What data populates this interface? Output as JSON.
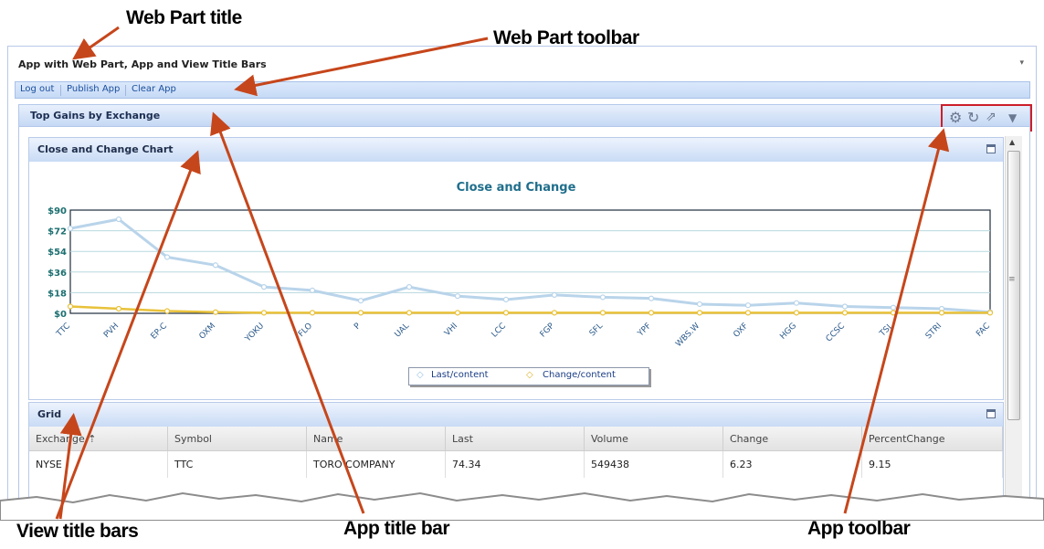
{
  "annotations": {
    "web_part_title": "Web Part title",
    "web_part_toolbar": "Web Part toolbar",
    "view_title_bars": "View title bars",
    "app_title_bar": "App title bar",
    "app_toolbar": "App toolbar"
  },
  "web_part": {
    "title": "App with Web Part, App and View Title Bars",
    "dropdown_glyph": "▾",
    "toolbar": {
      "log_out": "Log out",
      "publish_app": "Publish App",
      "clear_app": "Clear App"
    }
  },
  "app": {
    "title": "Top Gains by Exchange",
    "toolbar_icons": [
      "gear-icon",
      "refresh-icon",
      "popout-icon",
      "chevron-down-icon"
    ]
  },
  "views": {
    "chart_view_title": "Close and Change Chart",
    "grid_view_title": "Grid"
  },
  "chart_data": {
    "type": "line",
    "title": "Close and Change",
    "categories": [
      "TTC",
      "PVH",
      "EP-C",
      "OXM",
      "YOKU",
      "FLO",
      "P",
      "UAL",
      "VHI",
      "LCC",
      "FGP",
      "SFL",
      "YPF",
      "WBS.W",
      "OXF",
      "HGG",
      "CCSC",
      "TSL",
      "STRI",
      "FAC"
    ],
    "ytick_labels": [
      "$90",
      "$72",
      "$54",
      "$36",
      "$18",
      "$0"
    ],
    "ylim": [
      0,
      90
    ],
    "series": [
      {
        "name": "Last/content",
        "color": "#b9d4ea",
        "values": [
          74,
          82,
          49,
          42,
          23,
          20,
          11,
          23,
          15,
          12,
          16,
          14,
          13,
          8,
          7,
          9,
          6,
          5,
          4,
          1
        ]
      },
      {
        "name": "Change/content",
        "color": "#e9c23a",
        "values": [
          6,
          4,
          2,
          1,
          0.5,
          0.5,
          0.5,
          0.5,
          0.5,
          0.5,
          0.5,
          0.5,
          0.5,
          0.5,
          0.5,
          0.5,
          0.5,
          0.5,
          0.5,
          0.5
        ]
      }
    ],
    "legend_position": "bottom-center",
    "grid": true
  },
  "grid": {
    "columns": [
      "Exchange ⇡",
      "Symbol",
      "Name",
      "Last",
      "Volume",
      "Change",
      "PercentChange"
    ],
    "rows": [
      [
        "NYSE",
        "TTC",
        "TORO COMPANY",
        "74.34",
        "549438",
        "6.23",
        "9.15"
      ]
    ]
  }
}
